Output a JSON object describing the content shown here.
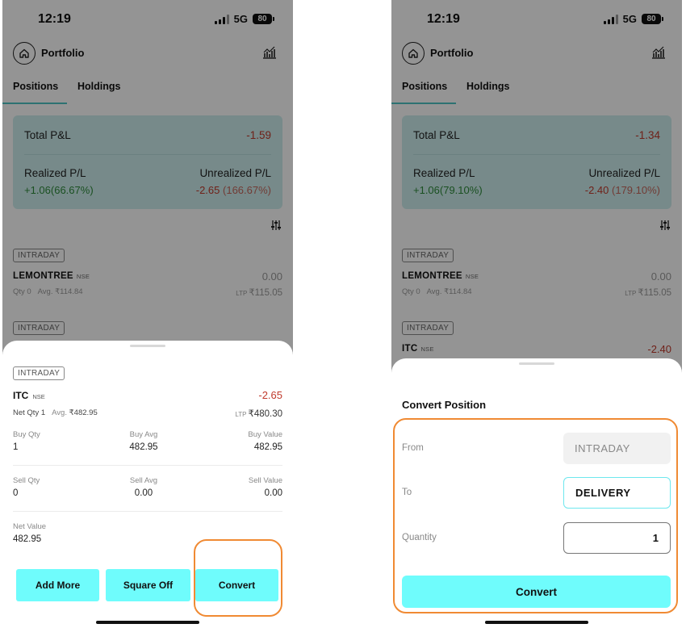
{
  "status_bar": {
    "time": "12:19",
    "network": "5G",
    "battery": "80"
  },
  "header": {
    "title": "Portfolio"
  },
  "tabs": [
    {
      "label": "Positions",
      "active": true
    },
    {
      "label": "Holdings",
      "active": false
    }
  ],
  "colors": {
    "accent": "#6ffcfc",
    "loss": "#c0392b",
    "profit": "#2e8b3a",
    "highlight": "#f08a33",
    "summary_bg": "#cdeeee"
  },
  "left": {
    "summary": {
      "total_label": "Total P&L",
      "total_value": "-1.59",
      "realized_label": "Realized P/L",
      "realized_value": "+1.06(66.67%)",
      "unrealized_label": "Unrealized P/L",
      "unrealized_value": "-2.65",
      "unrealized_pct": "(166.67%)"
    },
    "positions": [
      {
        "tag": "INTRADAY",
        "symbol": "LEMONTREE",
        "exchange": "NSE",
        "pl": "0.00",
        "qty_label": "Qty",
        "qty": "0",
        "avg_label": "Avg.",
        "avg": "₹114.84",
        "ltp_label": "LTP",
        "ltp": "₹115.05"
      },
      {
        "tag": "INTRADAY"
      }
    ],
    "detail": {
      "tag": "INTRADAY",
      "symbol": "ITC",
      "exchange": "NSE",
      "pl": "-2.65",
      "net_qty_label": "Net Qty",
      "net_qty": "1",
      "avg_label": "Avg.",
      "avg": "₹482.95",
      "ltp_label": "LTP",
      "ltp": "₹480.30",
      "buy_qty_label": "Buy Qty",
      "buy_qty": "1",
      "buy_avg_label": "Buy Avg",
      "buy_avg": "482.95",
      "buy_value_label": "Buy Value",
      "buy_value": "482.95",
      "sell_qty_label": "Sell Qty",
      "sell_qty": "0",
      "sell_avg_label": "Sell Avg",
      "sell_avg": "0.00",
      "sell_value_label": "Sell Value",
      "sell_value": "0.00",
      "net_value_label": "Net Value",
      "net_value": "482.95"
    },
    "buttons": {
      "add_more": "Add More",
      "square_off": "Square Off",
      "convert": "Convert"
    }
  },
  "right": {
    "summary": {
      "total_label": "Total P&L",
      "total_value": "-1.34",
      "realized_label": "Realized P/L",
      "realized_value": "+1.06(79.10%)",
      "unrealized_label": "Unrealized P/L",
      "unrealized_value": "-2.40",
      "unrealized_pct": "(179.10%)"
    },
    "positions": [
      {
        "tag": "INTRADAY",
        "symbol": "LEMONTREE",
        "exchange": "NSE",
        "pl": "0.00",
        "qty_label": "Qty",
        "qty": "0",
        "avg_label": "Avg.",
        "avg": "₹114.84",
        "ltp_label": "LTP",
        "ltp": "₹115.05"
      },
      {
        "tag": "INTRADAY",
        "symbol": "ITC",
        "exchange": "NSE",
        "pl": "-2.40"
      }
    ],
    "convert": {
      "title": "Convert Position",
      "from_label": "From",
      "from_value": "INTRADAY",
      "to_label": "To",
      "to_value": "DELIVERY",
      "qty_label": "Quantity",
      "qty_value": "1",
      "submit": "Convert"
    }
  }
}
